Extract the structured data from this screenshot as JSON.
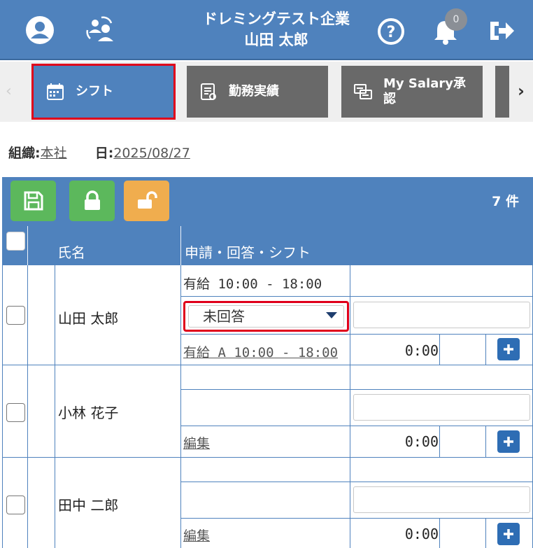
{
  "header": {
    "company": "ドレミングテスト企業",
    "user": "山田 太郎",
    "notification_count": "0",
    "icons": [
      "user-circle-icon",
      "switch-users-icon",
      "help-icon",
      "bell-icon",
      "logout-icon"
    ]
  },
  "tabs": [
    {
      "label": "シフト",
      "icon": "calendar-icon",
      "active": true
    },
    {
      "label": "勤務実績",
      "icon": "document-icon",
      "active": false
    },
    {
      "label": "My Salary承認",
      "icon": "approval-icon",
      "active": false
    }
  ],
  "org_line": {
    "org_key": "組織:",
    "org_value": "本社",
    "date_key": "日:",
    "date_value": "2025/08/27"
  },
  "toolbar": {
    "count": "7 件",
    "buttons": [
      "save-icon",
      "lock-icon",
      "unlock-icon"
    ]
  },
  "table": {
    "headers": {
      "name": "氏名",
      "request": "申請・回答・シフト"
    },
    "rows": [
      {
        "name": "山田 太郎",
        "request_text": "有給 10:00 - 18:00",
        "answer_select": "未回答",
        "shift_link": "有給 A 10:00 - 18:00",
        "time": "0:00"
      },
      {
        "name": "小林 花子",
        "request_text": "",
        "shift_link": "編集",
        "time": "0:00"
      },
      {
        "name": "田中 二郎",
        "request_text": "",
        "shift_link": "編集",
        "time": "0:00"
      }
    ]
  },
  "colors": {
    "primary": "#4f82bd",
    "tab_inactive": "#696969",
    "highlight": "#e0001b",
    "green": "#5cb85c",
    "orange": "#f0ad4e",
    "plus_button": "#2e6db4"
  }
}
